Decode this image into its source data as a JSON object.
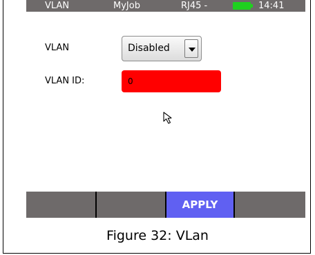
{
  "statusbar": {
    "title": "VLAN",
    "job": "MyJob",
    "port": "RJ45 -",
    "time": "14:41",
    "battery_color": "#1fd11f"
  },
  "form": {
    "vlan_label": "VLAN",
    "vlan_value": "Disabled",
    "vlan_id_label": "VLAN ID:",
    "vlan_id_value": "0"
  },
  "function_keys": {
    "f1": "",
    "f2": "",
    "f3": "APPLY",
    "f4": ""
  },
  "caption": "Figure 32: VLan",
  "colors": {
    "statusbar_bg": "#6e6a6a",
    "apply_bg": "#6060f2",
    "error_field": "#ff0000"
  }
}
